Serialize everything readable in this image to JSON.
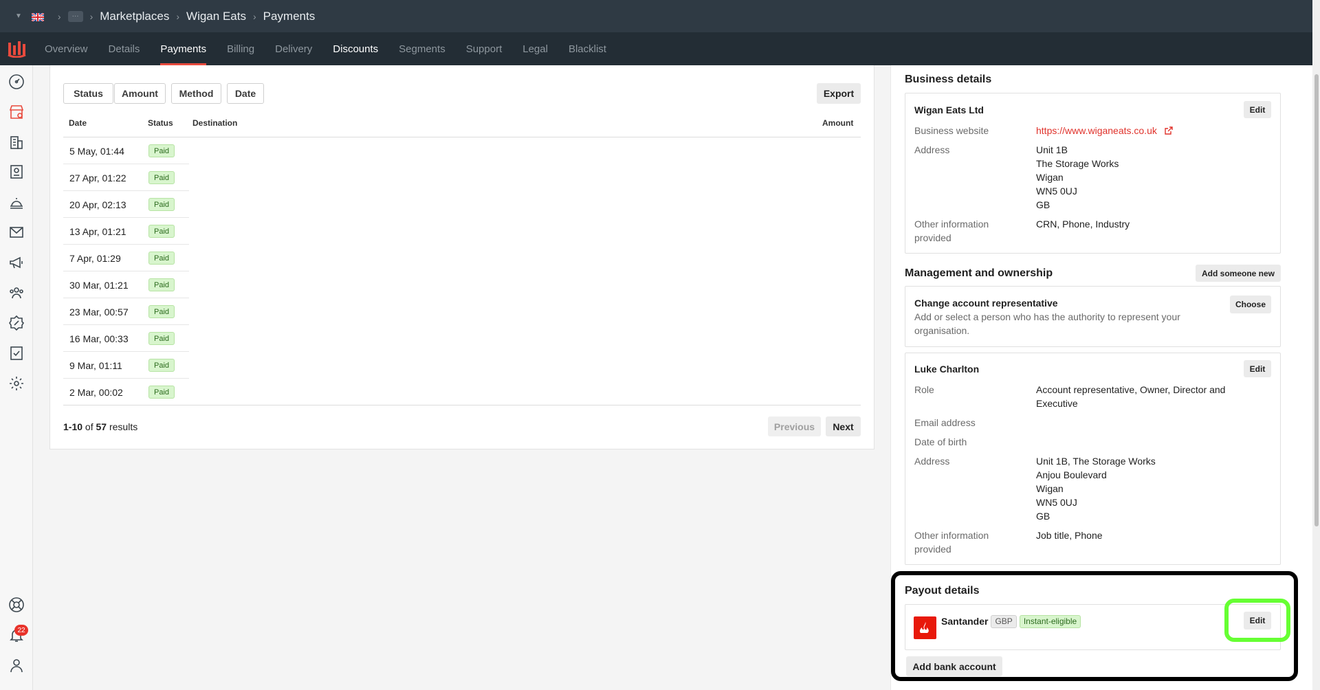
{
  "breadcrumbs": [
    "Marketplaces",
    "Wigan Eats",
    "Payments"
  ],
  "tabs": [
    "Overview",
    "Details",
    "Payments",
    "Billing",
    "Delivery",
    "Discounts",
    "Segments",
    "Support",
    "Legal",
    "Blacklist"
  ],
  "notifications_count": "22",
  "filters": [
    "Status",
    "Amount",
    "Method",
    "Date"
  ],
  "export_label": "Export",
  "table": {
    "headers": [
      "Date",
      "Status",
      "Destination",
      "Amount"
    ],
    "rows": [
      {
        "date": "5 May, 01:44",
        "status": "Paid"
      },
      {
        "date": "27 Apr, 01:22",
        "status": "Paid"
      },
      {
        "date": "20 Apr, 02:13",
        "status": "Paid"
      },
      {
        "date": "13 Apr, 01:21",
        "status": "Paid"
      },
      {
        "date": "7 Apr, 01:29",
        "status": "Paid"
      },
      {
        "date": "30 Mar, 01:21",
        "status": "Paid"
      },
      {
        "date": "23 Mar, 00:57",
        "status": "Paid"
      },
      {
        "date": "16 Mar, 00:33",
        "status": "Paid"
      },
      {
        "date": "9 Mar, 01:11",
        "status": "Paid"
      },
      {
        "date": "2 Mar, 00:02",
        "status": "Paid"
      }
    ]
  },
  "pagination": {
    "range": "1-10",
    "of": "of",
    "total": "57",
    "results": "results",
    "previous": "Previous",
    "next": "Next"
  },
  "business": {
    "section_title": "Business details",
    "name": "Wigan Eats Ltd",
    "edit": "Edit",
    "website_label": "Business website",
    "website": "https://www.wiganeats.co.uk",
    "address_label": "Address",
    "address": [
      "Unit 1B",
      "The Storage Works",
      "Wigan",
      "WN5 0UJ",
      "GB"
    ],
    "other_label": [
      "Other information",
      "provided"
    ],
    "other": "CRN, Phone, Industry"
  },
  "management": {
    "section_title": "Management and ownership",
    "add_someone": "Add someone new",
    "change_title": "Change account representative",
    "change_desc": [
      "Add or select a person who has the authority to represent your",
      "organisation."
    ],
    "choose": "Choose",
    "person": {
      "name": "Luke Charlton",
      "edit": "Edit",
      "role_label": "Role",
      "role": [
        "Account representative, Owner, Director and",
        "Executive"
      ],
      "email_label": "Email address",
      "dob_label": "Date of birth",
      "address_label": "Address",
      "address": [
        "Unit 1B, The Storage Works",
        "Anjou Boulevard",
        "Wigan",
        "WN5 0UJ",
        "GB"
      ],
      "other_label": [
        "Other information",
        "provided"
      ],
      "other": "Job title, Phone"
    }
  },
  "payout": {
    "section_title": "Payout details",
    "bank": "Santander",
    "currency": "GBP",
    "instant": "Instant-eligible",
    "edit": "Edit",
    "add_bank": "Add bank account"
  },
  "colors": {
    "brand": "#e84a3d",
    "link": "#e0322b",
    "highlight_green": "#66ff33"
  }
}
